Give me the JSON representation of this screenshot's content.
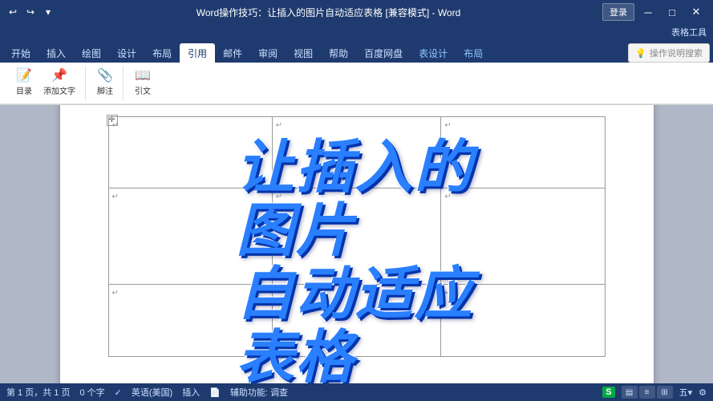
{
  "titlebar": {
    "title": "Word操作技巧：让插入的图片自动适应表格 [兼容模式] - Word",
    "app_name": "Word",
    "login_label": "登录",
    "undo_icon": "↩",
    "redo_icon": "↪",
    "quick_icon": "▾"
  },
  "table_tools": {
    "label": "表格工具",
    "design_label": "表设计",
    "layout_label": "布局"
  },
  "ribbon_tabs": [
    {
      "label": "开始",
      "active": false
    },
    {
      "label": "插入",
      "active": false
    },
    {
      "label": "绘图",
      "active": false
    },
    {
      "label": "设计",
      "active": false
    },
    {
      "label": "布局",
      "active": false
    },
    {
      "label": "引用",
      "active": true
    },
    {
      "label": "邮件",
      "active": false
    },
    {
      "label": "审阅",
      "active": false
    },
    {
      "label": "视图",
      "active": false
    },
    {
      "label": "帮助",
      "active": false
    },
    {
      "label": "百度网盘",
      "active": false
    },
    {
      "label": "表设计",
      "active": false,
      "special": true
    },
    {
      "label": "布局",
      "active": false,
      "special": true
    }
  ],
  "ribbon_commands": [
    {
      "icon": "💡",
      "label": "操作说明搜索",
      "is_search": true
    }
  ],
  "overlay": {
    "line1": "让插入的",
    "line2": "图片",
    "line3": "自动适应",
    "line4": "表格"
  },
  "status_bar": {
    "pages": "第 1 页，共 1 页",
    "words": "0 个字",
    "language": "英语(美国)",
    "insert_label": "插入",
    "accessibility": "辅助功能: 调查",
    "sogou": "S",
    "page_num_right": "五▾ ⚙"
  },
  "table_cells": [
    [
      {
        "text": "↵"
      },
      {
        "text": "↵"
      },
      {
        "text": "↵"
      }
    ],
    [
      {
        "text": "↵"
      },
      {
        "text": "↵"
      },
      {
        "text": "↵"
      }
    ],
    [
      {
        "text": "↵"
      },
      {
        "text": ""
      },
      {
        "text": "↵"
      }
    ]
  ]
}
